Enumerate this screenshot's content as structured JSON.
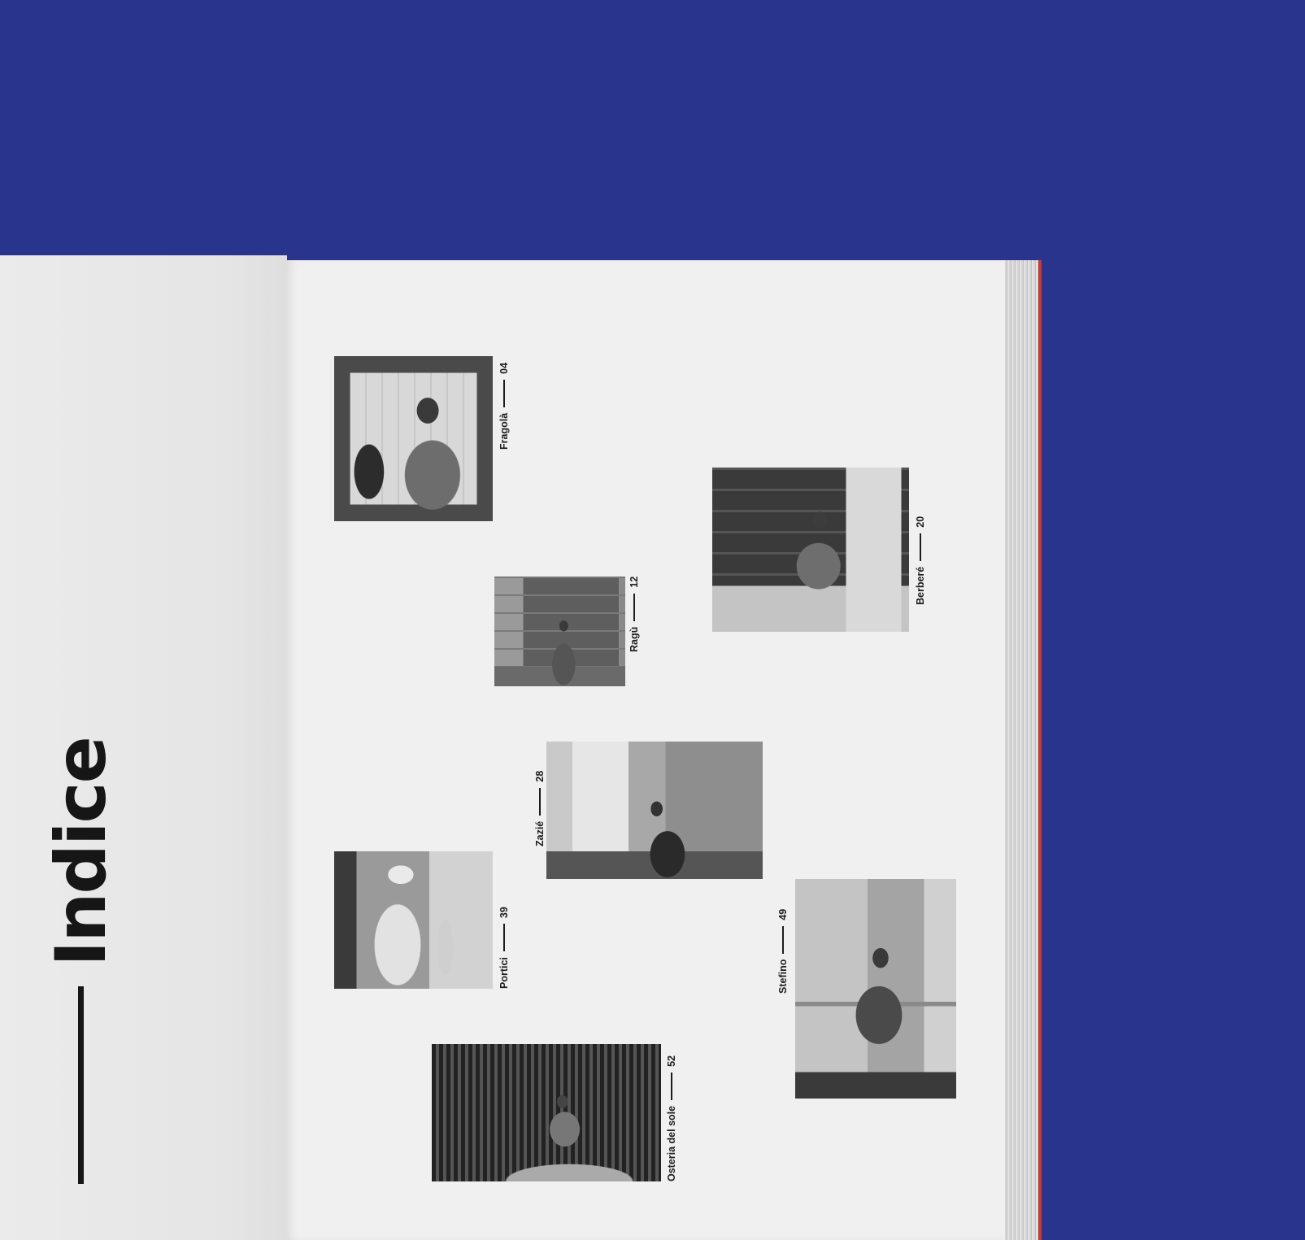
{
  "title": "Indice",
  "entries": [
    {
      "name": "Fragolà",
      "page": "04"
    },
    {
      "name": "Ragù",
      "page": "12"
    },
    {
      "name": "Berberé",
      "page": "20"
    },
    {
      "name": "Zazié",
      "page": "28"
    },
    {
      "name": "Portici",
      "page": "39"
    },
    {
      "name": "Stefino",
      "page": "49"
    },
    {
      "name": "Osteria del sole",
      "page": "52"
    }
  ],
  "colors": {
    "background": "#29348c",
    "paper": "#f0f0f0",
    "ink": "#161616",
    "edge_accent": "#c83a3a"
  }
}
